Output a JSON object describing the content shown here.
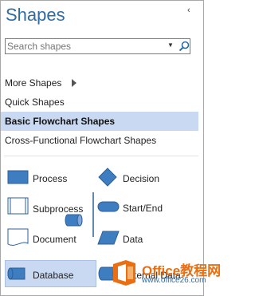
{
  "panel": {
    "title": "Shapes"
  },
  "search": {
    "placeholder": "Search shapes"
  },
  "nav": {
    "more_shapes": "More Shapes",
    "quick_shapes": "Quick Shapes",
    "basic_flowchart": "Basic Flowchart Shapes",
    "cross_functional": "Cross-Functional Flowchart Shapes"
  },
  "shapes": {
    "process": "Process",
    "decision": "Decision",
    "subprocess": "Subprocess",
    "start_end": "Start/End",
    "document": "Document",
    "data": "Data",
    "database": "Database",
    "external_data": "External Data"
  },
  "watermark": {
    "title": "Office教程网",
    "url": "www.office26.com"
  },
  "colors": {
    "title": "#2e6ca4",
    "shape_fill": "#3f7dc1",
    "selected": "#c9d9f2",
    "watermark": "#e96f12"
  }
}
